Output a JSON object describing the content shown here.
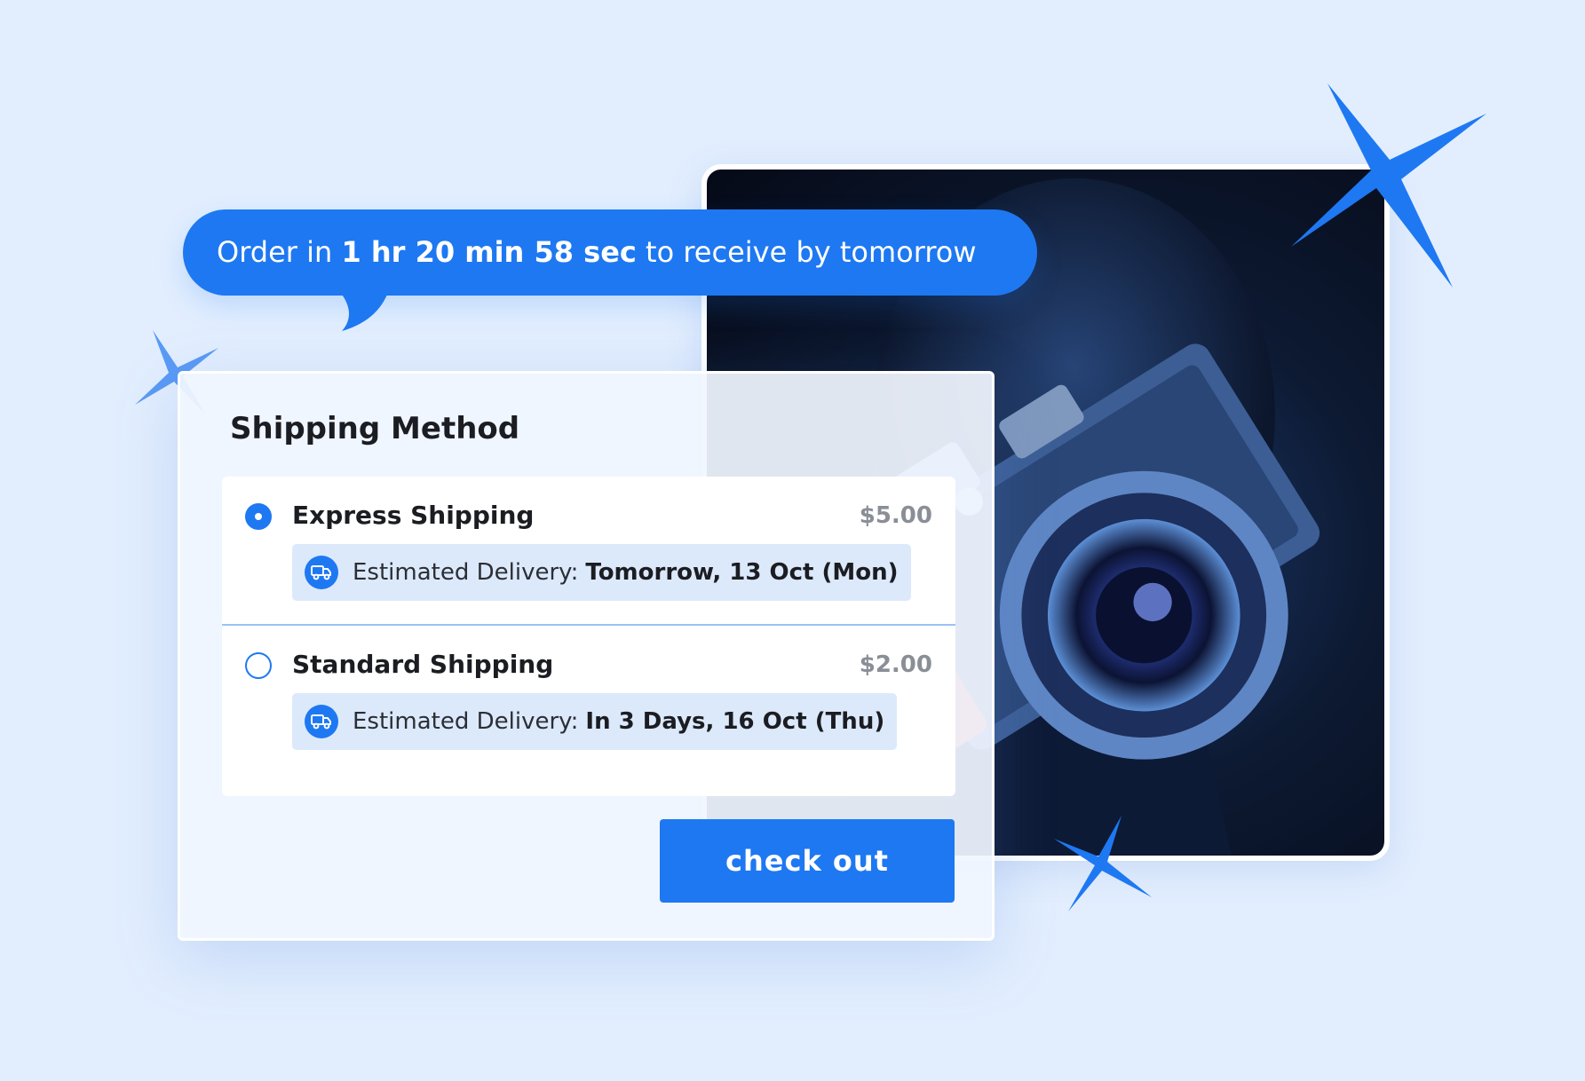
{
  "banner": {
    "prefix": "Order in",
    "countdown": "1 hr 20 min 58 sec",
    "suffix": "to receive by tomorrow"
  },
  "shipping": {
    "title": "Shipping Method",
    "options": [
      {
        "name": "Express Shipping",
        "price": "$5.00",
        "selected": true,
        "delivery_label": "Estimated Delivery:",
        "delivery_value": "Tomorrow, 13 Oct (Mon)",
        "icon": "truck-icon"
      },
      {
        "name": "Standard Shipping",
        "price": "$2.00",
        "selected": false,
        "delivery_label": "Estimated Delivery:",
        "delivery_value": "In 3 Days, 16 Oct (Thu)",
        "icon": "truck-icon"
      }
    ],
    "checkout_label": "check out"
  },
  "colors": {
    "accent": "#1e78f2",
    "background": "#e2eefe",
    "delivery_pill": "#dce9fb"
  }
}
